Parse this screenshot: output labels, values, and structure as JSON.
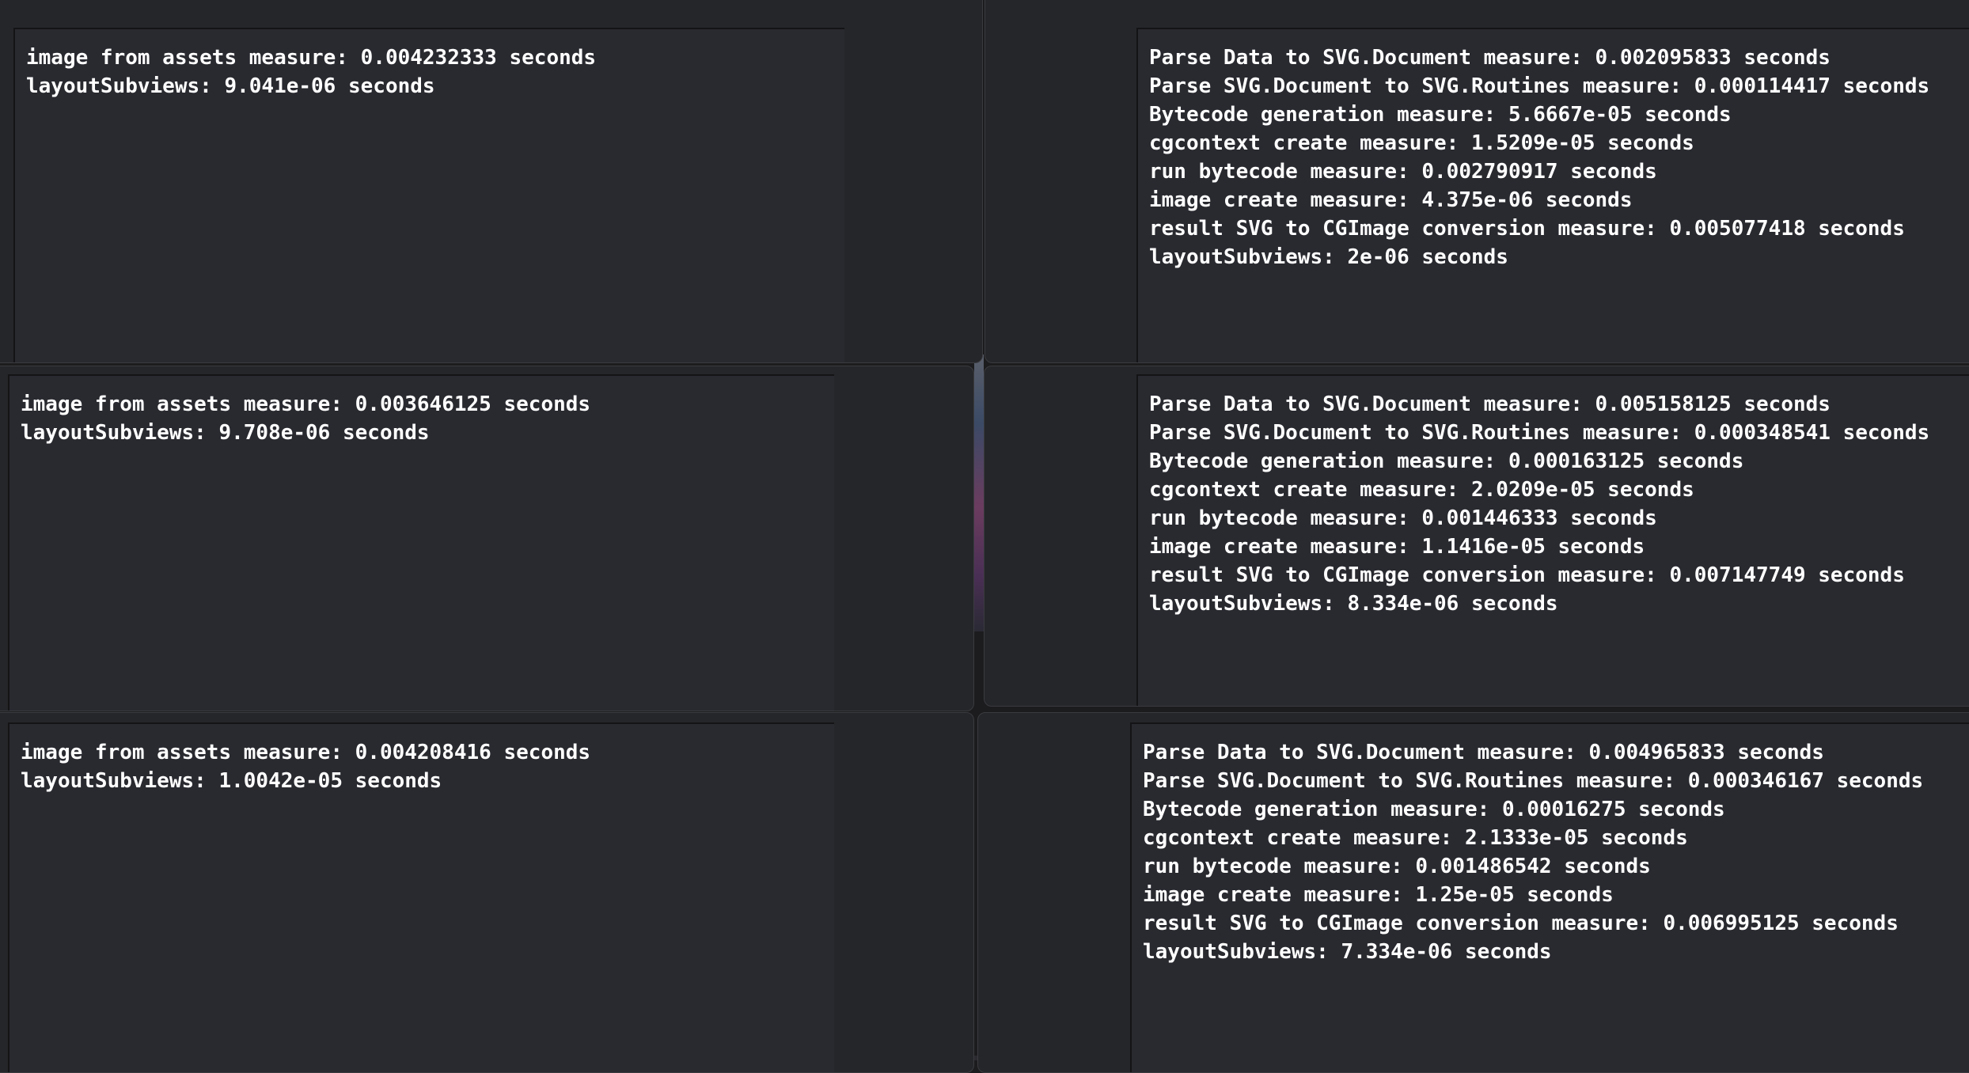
{
  "panels": [
    {
      "lines": [
        "image from assets measure: 0.004232333 seconds",
        "layoutSubviews: 9.041e-06 seconds"
      ]
    },
    {
      "lines": [
        "Parse Data to SVG.Document measure: 0.002095833 seconds",
        "Parse SVG.Document to SVG.Routines measure: 0.000114417 seconds",
        "Bytecode generation measure: 5.6667e-05 seconds",
        "cgcontext create measure: 1.5209e-05 seconds",
        "run bytecode measure: 0.002790917 seconds",
        "image create measure: 4.375e-06 seconds",
        "result SVG to CGImage conversion measure: 0.005077418 seconds",
        "layoutSubviews: 2e-06 seconds"
      ]
    },
    {
      "lines": [
        "image from assets measure: 0.003646125 seconds",
        "layoutSubviews: 9.708e-06 seconds"
      ]
    },
    {
      "lines": [
        "Parse Data to SVG.Document measure: 0.005158125 seconds",
        "Parse SVG.Document to SVG.Routines measure: 0.000348541 seconds",
        "Bytecode generation measure: 0.000163125 seconds",
        "cgcontext create measure: 2.0209e-05 seconds",
        "run bytecode measure: 0.001446333 seconds",
        "image create measure: 1.1416e-05 seconds",
        "result SVG to CGImage conversion measure: 0.007147749 seconds",
        "layoutSubviews: 8.334e-06 seconds"
      ]
    },
    {
      "lines": [
        "image from assets measure: 0.004208416 seconds",
        "layoutSubviews: 1.0042e-05 seconds"
      ]
    },
    {
      "lines": [
        "Parse Data to SVG.Document measure: 0.004965833 seconds",
        "Parse SVG.Document to SVG.Routines measure: 0.000346167 seconds",
        "Bytecode generation measure: 0.00016275 seconds",
        "cgcontext create measure: 2.1333e-05 seconds",
        "run bytecode measure: 0.001486542 seconds",
        "image create measure: 1.25e-05 seconds",
        "result SVG to CGImage conversion measure: 0.006995125 seconds",
        "layoutSubviews: 7.334e-06 seconds"
      ]
    }
  ]
}
